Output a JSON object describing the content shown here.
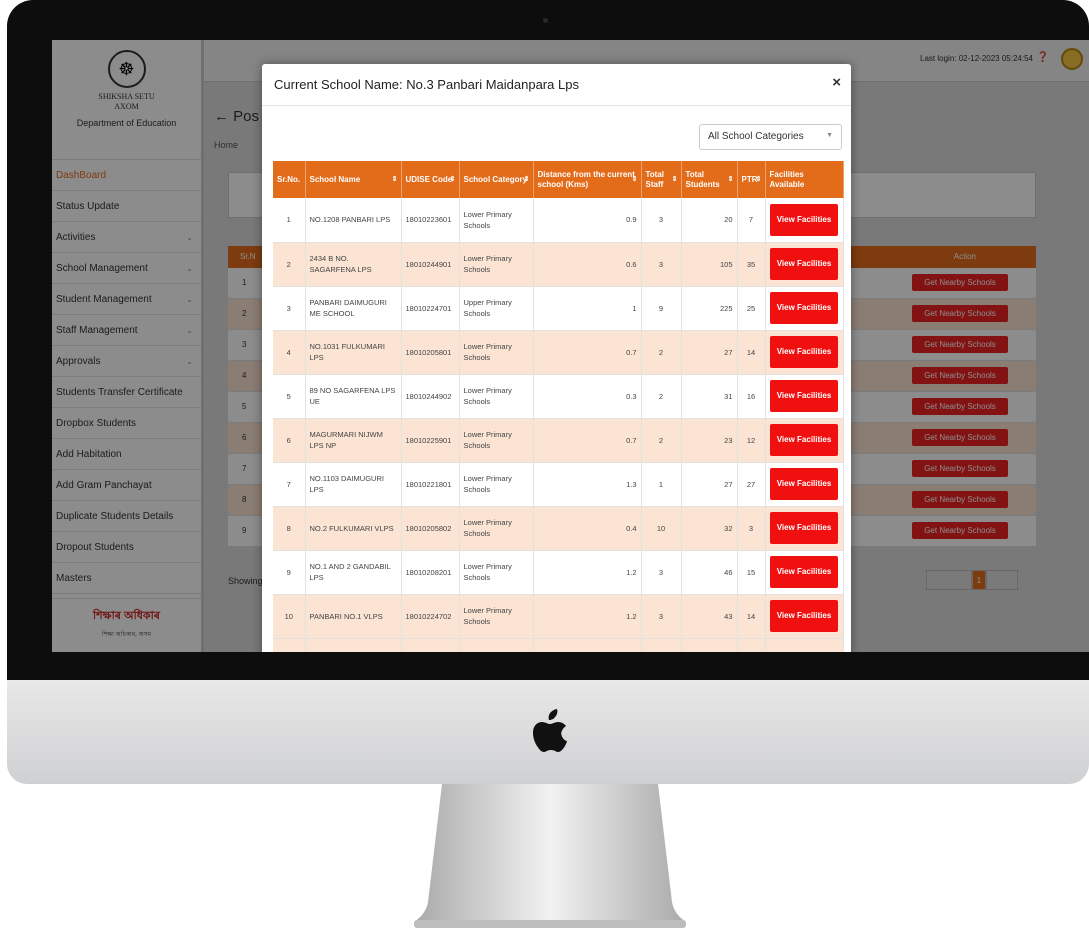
{
  "app": {
    "brand_name": "SHIKSHA SETU AXOM",
    "department": "Department of Education",
    "last_login": "Last login: 02-12-2023 05:24:54",
    "page_title": "← Pos",
    "breadcrumb": "Home",
    "sidebar_items": [
      {
        "label": "DashBoard",
        "chevron": ""
      },
      {
        "label": "Status Update",
        "chevron": ""
      },
      {
        "label": "Activities",
        "chevron": "⌄"
      },
      {
        "label": "School Management",
        "chevron": "⌄"
      },
      {
        "label": "Student Management",
        "chevron": "⌄"
      },
      {
        "label": "Staff Management",
        "chevron": "⌄"
      },
      {
        "label": "Approvals",
        "chevron": "⌄"
      },
      {
        "label": "Students Transfer Certificate",
        "chevron": ""
      },
      {
        "label": "Dropbox Students",
        "chevron": ""
      },
      {
        "label": "Add Habitation",
        "chevron": ""
      },
      {
        "label": "Add Gram Panchayat",
        "chevron": ""
      },
      {
        "label": "Duplicate Students Details",
        "chevron": ""
      },
      {
        "label": "Dropout Students",
        "chevron": ""
      },
      {
        "label": "Masters",
        "chevron": ""
      }
    ],
    "footer_logo": "শিক্ষাৰ অধিকাৰ",
    "footer_sub": "শিক্ষা অধিকাৰ, অসম",
    "bg_table": {
      "sr_header": "Sr.N",
      "action_header": "Action",
      "nearby_label": "Get Nearby Schools",
      "rows": [
        "1",
        "2",
        "3",
        "4",
        "5",
        "6",
        "7",
        "8",
        "9"
      ]
    },
    "showing": "Showing",
    "pagination": {
      "prev": "",
      "current": "1",
      "next": ""
    }
  },
  "modal": {
    "title": "Current School Name: No.3 Panbari Maidanpara Lps",
    "close": "×",
    "category_select": "All School Categories",
    "columns": [
      "Sr.No.",
      "School Name",
      "UDISE Code",
      "School Category",
      "Distance from the current school (Kms)",
      "Total Staff",
      "Total Students",
      "PTR",
      "Facilities Available"
    ],
    "button_label": "View Facilities",
    "rows": [
      {
        "sr": "1",
        "name": "NO.1208 PANBARI LPS",
        "udise": "18010223601",
        "category": "Lower Primary Schools",
        "distance": "0.9",
        "staff": "3",
        "students": "20",
        "ptr": "7"
      },
      {
        "sr": "2",
        "name": "2434 B NO. SAGARFENA LPS",
        "udise": "18010244901",
        "category": "Lower Primary Schools",
        "distance": "0.6",
        "staff": "3",
        "students": "105",
        "ptr": "35"
      },
      {
        "sr": "3",
        "name": "PANBARI DAIMUGURI ME SCHOOL",
        "udise": "18010224701",
        "category": "Upper Primary Schools",
        "distance": "1",
        "staff": "9",
        "students": "225",
        "ptr": "25"
      },
      {
        "sr": "4",
        "name": "NO.1031 FULKUMARI LPS",
        "udise": "18010205801",
        "category": "Lower Primary Schools",
        "distance": "0.7",
        "staff": "2",
        "students": "27",
        "ptr": "14"
      },
      {
        "sr": "5",
        "name": "89 NO SAGARFENA LPS UE",
        "udise": "18010244902",
        "category": "Lower Primary Schools",
        "distance": "0.3",
        "staff": "2",
        "students": "31",
        "ptr": "16"
      },
      {
        "sr": "6",
        "name": "MAGURMARI NIJWM LPS NP",
        "udise": "18010225901",
        "category": "Lower Primary Schools",
        "distance": "0.7",
        "staff": "2",
        "students": "23",
        "ptr": "12"
      },
      {
        "sr": "7",
        "name": "NO.1103 DAIMUGURI LPS",
        "udise": "18010221801",
        "category": "Lower Primary Schools",
        "distance": "1.3",
        "staff": "1",
        "students": "27",
        "ptr": "27"
      },
      {
        "sr": "8",
        "name": "NO.2 FULKUMARI VLPS",
        "udise": "18010205802",
        "category": "Lower Primary Schools",
        "distance": "0.4",
        "staff": "10",
        "students": "32",
        "ptr": "3"
      },
      {
        "sr": "9",
        "name": "NO.1 AND 2 GANDABIL LPS",
        "udise": "18010208201",
        "category": "Lower Primary Schools",
        "distance": "1.2",
        "staff": "3",
        "students": "46",
        "ptr": "15"
      },
      {
        "sr": "10",
        "name": "PANBARI NO.1 VLPS",
        "udise": "18010224702",
        "category": "Lower Primary Schools",
        "distance": "1.2",
        "staff": "3",
        "students": "43",
        "ptr": "14"
      }
    ]
  }
}
